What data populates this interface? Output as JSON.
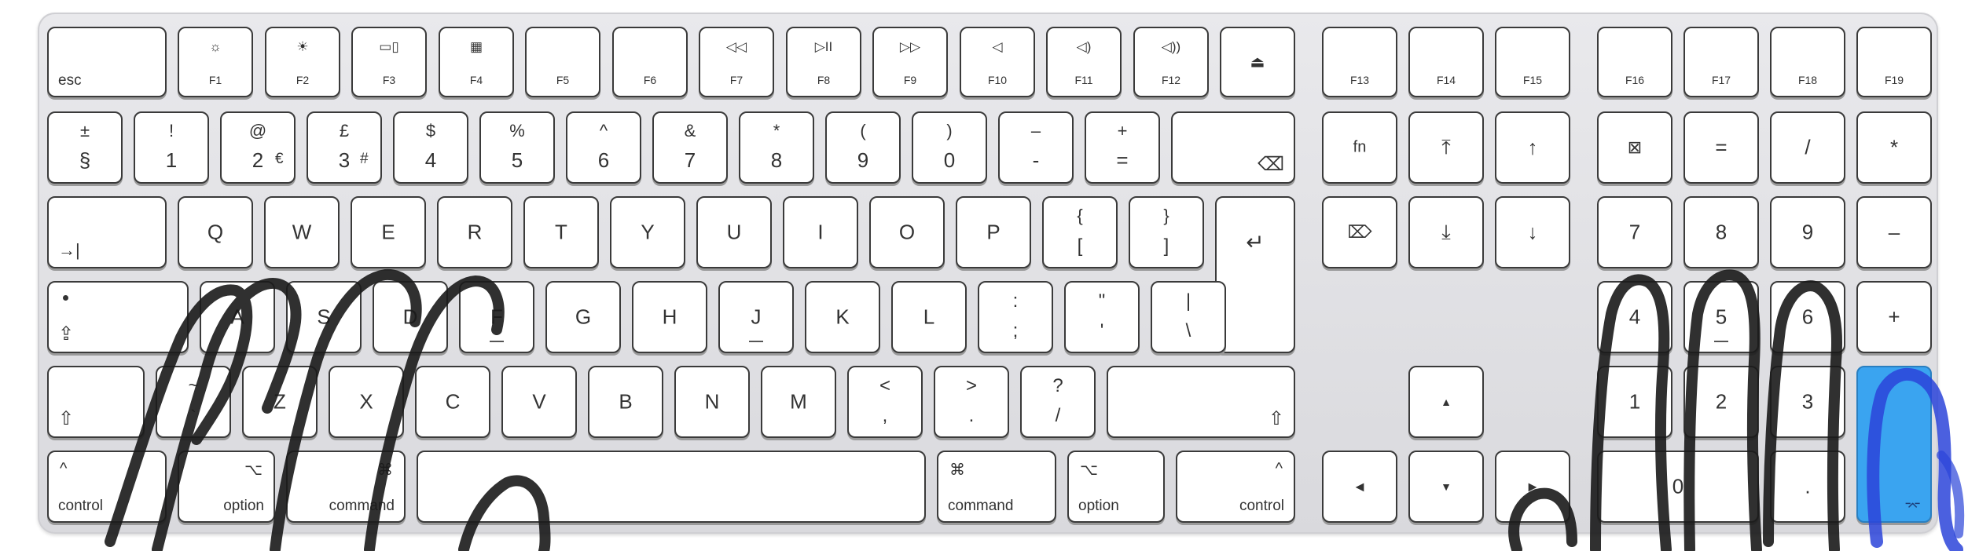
{
  "fn_row": {
    "esc": "esc",
    "f1": "F1",
    "f2": "F2",
    "f3": "F3",
    "f4": "F4",
    "f5": "F5",
    "f6": "F6",
    "f7": "F7",
    "f8": "F8",
    "f9": "F9",
    "f10": "F10",
    "f11": "F11",
    "f12": "F12",
    "f13": "F13",
    "f14": "F14",
    "f15": "F15",
    "f16": "F16",
    "f17": "F17",
    "f18": "F18",
    "f19": "F19",
    "icons": {
      "f1": "☼",
      "f2": "☀",
      "f3": "▭▯",
      "f4": "▦",
      "f7": "◁◁",
      "f8": "▷II",
      "f9": "▷▷",
      "f10": "◁",
      "f11": "◁)",
      "f12": "◁))",
      "eject": "⏏"
    }
  },
  "number_row": {
    "section": {
      "top": "±",
      "bottom": "§"
    },
    "k1": {
      "top": "!",
      "bottom": "1"
    },
    "k2": {
      "top": "@",
      "bottom": "2",
      "alt": "€"
    },
    "k3": {
      "top": "£",
      "bottom": "3",
      "alt": "#"
    },
    "k4": {
      "top": "$",
      "bottom": "4"
    },
    "k5": {
      "top": "%",
      "bottom": "5"
    },
    "k6": {
      "top": "^",
      "bottom": "6"
    },
    "k7": {
      "top": "&",
      "bottom": "7"
    },
    "k8": {
      "top": "*",
      "bottom": "8"
    },
    "k9": {
      "top": "(",
      "bottom": "9"
    },
    "k0": {
      "top": ")",
      "bottom": "0"
    },
    "minus": {
      "top": "–",
      "bottom": "-"
    },
    "equals": {
      "top": "+",
      "bottom": "="
    },
    "backspace_icon": "⌫",
    "fn": "fn",
    "home_icon": "⤒",
    "pageup_icon": "↑"
  },
  "keypad": {
    "clear_icon": "⊠",
    "equals": "=",
    "divide": "/",
    "multiply": "*",
    "k7": "7",
    "k8": "8",
    "k9": "9",
    "minus": "–",
    "k4": "4",
    "k5": "5",
    "k6": "6",
    "plus": "+",
    "k1": "1",
    "k2": "2",
    "k3": "3",
    "k0": "0",
    "dot": ".",
    "enter_icon": "⌤"
  },
  "qwerty_row": {
    "tab_icon": "→|",
    "letters": [
      "Q",
      "W",
      "E",
      "R",
      "T",
      "Y",
      "U",
      "I",
      "O",
      "P"
    ],
    "lbrace": {
      "top": "{",
      "bottom": "["
    },
    "rbrace": {
      "top": "}",
      "bottom": "]"
    },
    "return_icon": "↵",
    "fwd_delete_icon": "⌦",
    "end_icon": "⤓",
    "pagedown_icon": "↓"
  },
  "home_row": {
    "caps_icon": "⇪",
    "letters": [
      "A",
      "S",
      "D",
      "F",
      "G",
      "H",
      "J",
      "K",
      "L"
    ],
    "semicolon": {
      "top": ":",
      "bottom": ";"
    },
    "quote": {
      "top": "\"",
      "bottom": "'"
    },
    "pipe": {
      "top": "|",
      "bottom": "\\"
    }
  },
  "shift_row": {
    "shift_icon": "⇧",
    "tilde": {
      "top": "~",
      "bottom": "`"
    },
    "letters": [
      "Z",
      "X",
      "C",
      "V",
      "B",
      "N",
      "M"
    ],
    "comma": {
      "top": "<",
      "bottom": ","
    },
    "period": {
      "top": ">",
      "bottom": "."
    },
    "slash": {
      "top": "?",
      "bottom": "/"
    },
    "up_icon": "▲"
  },
  "bottom_row": {
    "control": "control",
    "control_icon": "^",
    "option": "option",
    "option_icon": "⌥",
    "command": "command",
    "command_icon": "⌘",
    "left_icon": "◀",
    "down_icon": "▼",
    "right_icon": "▶"
  },
  "colors": {
    "highlight": "#3aa4f0",
    "scribble_dark": "#1a1a1a",
    "scribble_blue": "#2b44d9"
  }
}
